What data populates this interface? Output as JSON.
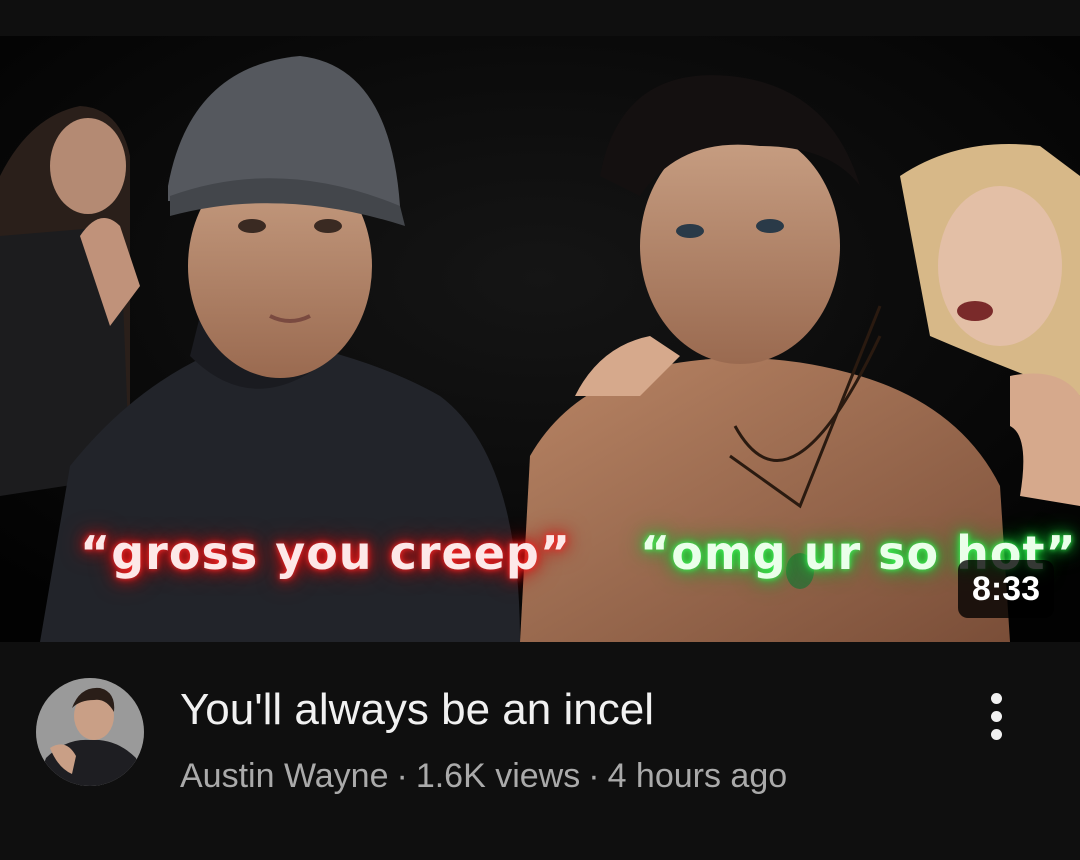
{
  "video": {
    "thumbnail": {
      "caption_left": "“gross you creep”",
      "caption_right": "“omg ur so hot”",
      "duration": "8:33",
      "colors": {
        "left_glow": "#e01010",
        "right_glow": "#18d93a"
      }
    },
    "title": "You'll always be an incel",
    "channel": "Austin Wayne",
    "views": "1.6K views",
    "age": "4 hours ago",
    "separator": "·",
    "more_icon": "more-vertical-icon"
  }
}
